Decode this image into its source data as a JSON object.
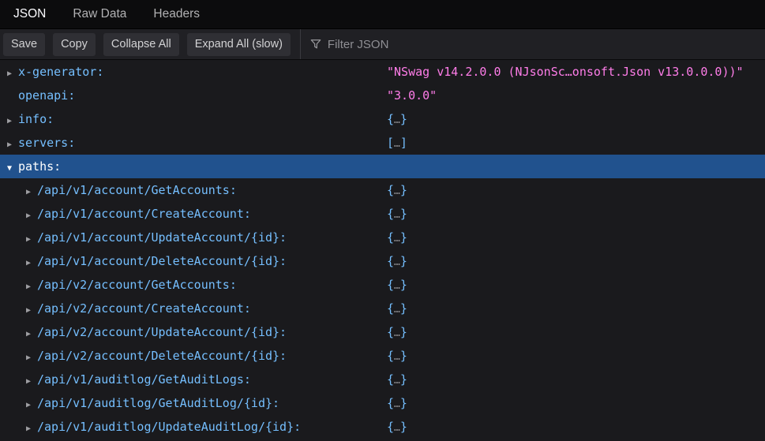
{
  "tabs": [
    {
      "id": "json",
      "label": "JSON",
      "active": true
    },
    {
      "id": "rawdata",
      "label": "Raw Data",
      "active": false
    },
    {
      "id": "headers",
      "label": "Headers",
      "active": false
    }
  ],
  "toolbar": {
    "save_label": "Save",
    "copy_label": "Copy",
    "collapse_all_label": "Collapse All",
    "expand_all_label": "Expand All (slow)",
    "filter_placeholder": "Filter JSON",
    "filter_icon": "funnel-icon"
  },
  "colors": {
    "tabbar_bg": "#0c0c0d",
    "tab_active": "#fbfbfe",
    "tab_inactive": "#b1b1b3",
    "toolbar_bg": "#202024",
    "button_bg": "#2f2f34",
    "button_text": "#d2d2d4",
    "placeholder_text": "#8f8f94",
    "content_bg": "#1a1a1d",
    "accent_key": "#75bfff",
    "string_value": "#ff7de9",
    "dots_color": "#8e8e92",
    "twisty_color": "#9e9ea2",
    "selection_bg": "#21528e",
    "selection_text": "#ffffff"
  },
  "viewer": {
    "rows": [
      {
        "key": "x-generator:",
        "level": 0,
        "twisty": "collapsed",
        "selected": false,
        "value_type": "string",
        "value": "\"NSwag v14.2.0.0 (NJsonSc…onsoft.Json v13.0.0.0))\""
      },
      {
        "key": "openapi:",
        "level": 0,
        "twisty": "none",
        "selected": false,
        "value_type": "string",
        "value": "\"3.0.0\""
      },
      {
        "key": "info:",
        "level": 0,
        "twisty": "collapsed",
        "selected": false,
        "value_type": "object_summary",
        "value": "{…}"
      },
      {
        "key": "servers:",
        "level": 0,
        "twisty": "collapsed",
        "selected": false,
        "value_type": "array_summary",
        "value": "[…]"
      },
      {
        "key": "paths:",
        "level": 0,
        "twisty": "expanded",
        "selected": true,
        "value_type": "none",
        "value": ""
      },
      {
        "key": "/api/v1/account/GetAccounts:",
        "level": 1,
        "twisty": "collapsed",
        "selected": false,
        "value_type": "object_summary",
        "value": "{…}"
      },
      {
        "key": "/api/v1/account/CreateAccount:",
        "level": 1,
        "twisty": "collapsed",
        "selected": false,
        "value_type": "object_summary",
        "value": "{…}"
      },
      {
        "key": "/api/v1/account/UpdateAccount/{id}:",
        "level": 1,
        "twisty": "collapsed",
        "selected": false,
        "value_type": "object_summary",
        "value": "{…}"
      },
      {
        "key": "/api/v1/account/DeleteAccount/{id}:",
        "level": 1,
        "twisty": "collapsed",
        "selected": false,
        "value_type": "object_summary",
        "value": "{…}"
      },
      {
        "key": "/api/v2/account/GetAccounts:",
        "level": 1,
        "twisty": "collapsed",
        "selected": false,
        "value_type": "object_summary",
        "value": "{…}"
      },
      {
        "key": "/api/v2/account/CreateAccount:",
        "level": 1,
        "twisty": "collapsed",
        "selected": false,
        "value_type": "object_summary",
        "value": "{…}"
      },
      {
        "key": "/api/v2/account/UpdateAccount/{id}:",
        "level": 1,
        "twisty": "collapsed",
        "selected": false,
        "value_type": "object_summary",
        "value": "{…}"
      },
      {
        "key": "/api/v2/account/DeleteAccount/{id}:",
        "level": 1,
        "twisty": "collapsed",
        "selected": false,
        "value_type": "object_summary",
        "value": "{…}"
      },
      {
        "key": "/api/v1/auditlog/GetAuditLogs:",
        "level": 1,
        "twisty": "collapsed",
        "selected": false,
        "value_type": "object_summary",
        "value": "{…}"
      },
      {
        "key": "/api/v1/auditlog/GetAuditLog/{id}:",
        "level": 1,
        "twisty": "collapsed",
        "selected": false,
        "value_type": "object_summary",
        "value": "{…}"
      },
      {
        "key": "/api/v1/auditlog/UpdateAuditLog/{id}:",
        "level": 1,
        "twisty": "collapsed",
        "selected": false,
        "value_type": "object_summary",
        "value": "{…}"
      }
    ]
  }
}
